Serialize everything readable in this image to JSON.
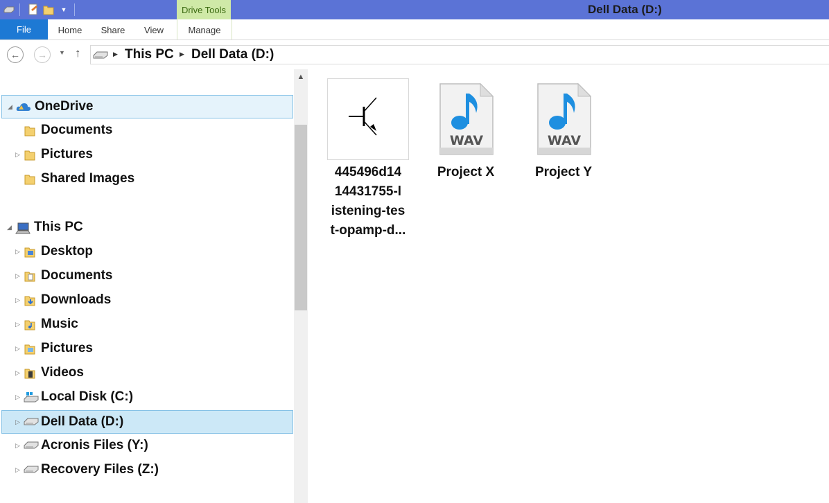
{
  "window": {
    "title": "Dell Data (D:)",
    "contextual_tab_group": "Drive Tools",
    "accent_color": "#5b73d6"
  },
  "ribbon": {
    "tabs": [
      "File",
      "Home",
      "Share",
      "View",
      "Manage"
    ]
  },
  "address": {
    "breadcrumbs": [
      "This PC",
      "Dell Data (D:)"
    ]
  },
  "navigation": {
    "groups": [
      {
        "label": "OneDrive",
        "icon": "onedrive-icon",
        "items": [
          {
            "label": "Documents",
            "icon": "folder-icon"
          },
          {
            "label": "Pictures",
            "icon": "folder-icon"
          },
          {
            "label": "Shared Images",
            "icon": "folder-icon"
          }
        ]
      },
      {
        "label": "This PC",
        "icon": "computer-icon",
        "items": [
          {
            "label": "Desktop",
            "icon": "desktop-folder-icon"
          },
          {
            "label": "Documents",
            "icon": "documents-folder-icon"
          },
          {
            "label": "Downloads",
            "icon": "downloads-folder-icon"
          },
          {
            "label": "Music",
            "icon": "music-folder-icon"
          },
          {
            "label": "Pictures",
            "icon": "pictures-folder-icon"
          },
          {
            "label": "Videos",
            "icon": "videos-folder-icon"
          },
          {
            "label": "Local Disk (C:)",
            "icon": "windows-drive-icon"
          },
          {
            "label": "Dell Data (D:)",
            "icon": "drive-icon",
            "selected": true
          },
          {
            "label": "Acronis Files (Y:)",
            "icon": "drive-icon"
          },
          {
            "label": "Recovery Files (Z:)",
            "icon": "drive-icon"
          }
        ]
      }
    ]
  },
  "files": [
    {
      "name": "445496d1414431755-listening-test-opamp-d...",
      "lines": [
        "445496d14",
        "14431755-l",
        "istening-tes",
        "t-opamp-d..."
      ],
      "icon": "transistor-thumbnail-icon"
    },
    {
      "name": "Project X",
      "lines": [
        "Project X"
      ],
      "icon": "wav-file-icon",
      "badge": "WAV"
    },
    {
      "name": "Project Y",
      "lines": [
        "Project Y"
      ],
      "icon": "wav-file-icon",
      "badge": "WAV"
    }
  ]
}
